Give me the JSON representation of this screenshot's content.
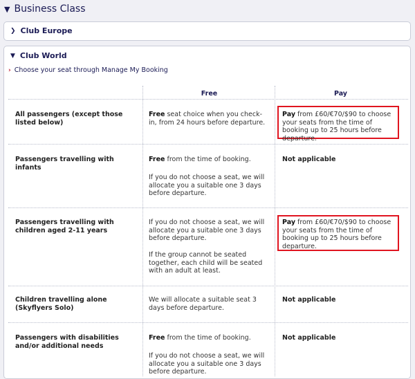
{
  "section": {
    "title": "Business Class"
  },
  "club_europe": {
    "label": "Club Europe"
  },
  "club_world": {
    "label": "Club World",
    "manage_link": "Choose your seat through Manage My Booking",
    "columns": {
      "free": "Free",
      "pay": "Pay"
    },
    "rows": [
      {
        "category": "All passengers (except those listed below)",
        "free_bold": "Free",
        "free_text": " seat choice when you check-in, from 24 hours before departure.",
        "pay_bold": "Pay",
        "pay_text": " from £60/€70/$90 to choose your seats from the time of booking up to 25 hours before departure."
      },
      {
        "category": "Passengers travelling with infants",
        "free_bold": "Free",
        "free_text": " from the time of booking.",
        "free_text2": "If you do not choose a seat, we will allocate you a suitable one 3 days before departure.",
        "pay_plain": "Not applicable"
      },
      {
        "category": "Passengers travelling with children aged 2-11 years",
        "free_text": "If you do not choose a seat, we will allocate you a suitable one 3 days before departure.",
        "free_text2": "If the group cannot be seated together, each child will be seated with an adult at least.",
        "pay_bold": "Pay",
        "pay_text": " from £60/€70/$90 to choose your seats from the time of booking up to 25 hours before departure."
      },
      {
        "category": "Children travelling alone (Skyflyers Solo)",
        "free_text": "We will allocate a suitable seat 3 days before departure.",
        "pay_plain": "Not applicable"
      },
      {
        "category": "Passengers with disabilities and/or additional needs",
        "free_bold": "Free",
        "free_text": " from the time of booking.",
        "free_text2": "If you do not choose a seat, we will allocate you a suitable one 3 days before departure.",
        "pay_plain": "Not applicable"
      }
    ]
  }
}
